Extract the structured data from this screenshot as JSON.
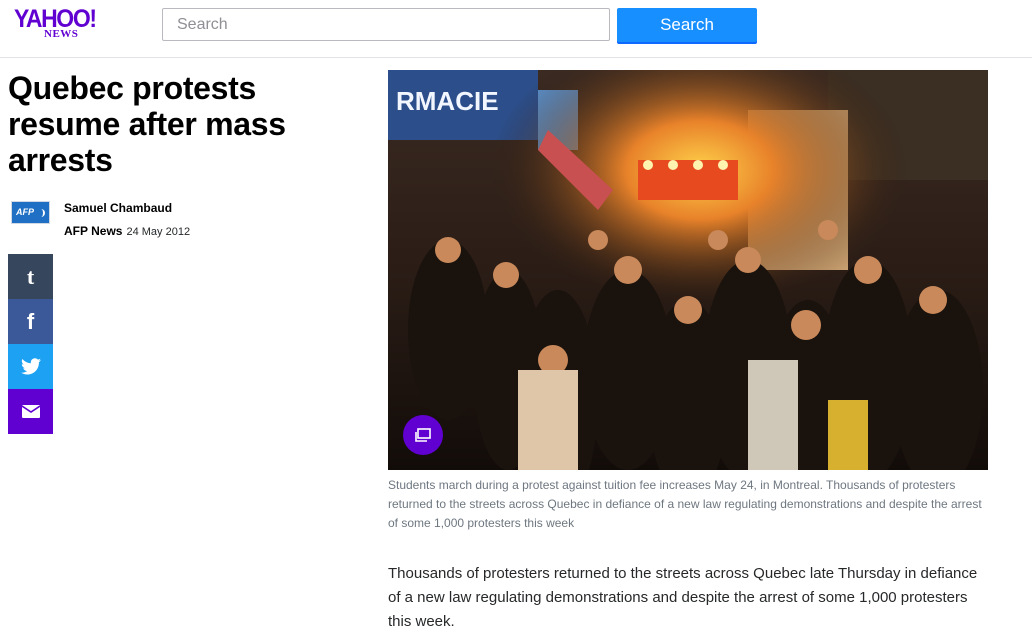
{
  "header": {
    "logo_text": "YAHOO!",
    "logo_sub": "NEWS",
    "search_placeholder": "Search",
    "search_button_label": "Search"
  },
  "article": {
    "title": "Quebec protests resume after mass arrests",
    "author": "Samuel Chambaud",
    "provider_logo_text": "AFP",
    "provider": "AFP News",
    "date": "24 May 2012",
    "photo_caption": "Students march during a protest against tuition fee increases May 24, in Montreal. Thousands of protesters returned to the streets across Quebec in defiance of a new law regulating demonstrations and despite the arrest of some 1,000 protesters this week",
    "photo_sign_text": "RMACIE",
    "body": "Thousands of protesters returned to the streets across Quebec late Thursday in defiance of a new law regulating demonstrations and despite the arrest of some 1,000 protesters this week."
  },
  "share": {
    "tumblr_glyph": "t",
    "facebook_glyph": "f",
    "icons": [
      "tumblr-icon",
      "facebook-icon",
      "twitter-icon",
      "mail-icon"
    ]
  },
  "colors": {
    "brand_purple": "#6001d2",
    "search_blue": "#188fff",
    "tumblr": "#36465d",
    "facebook": "#3b5998",
    "twitter": "#1da1f2",
    "caption_gray": "#6e7780"
  }
}
